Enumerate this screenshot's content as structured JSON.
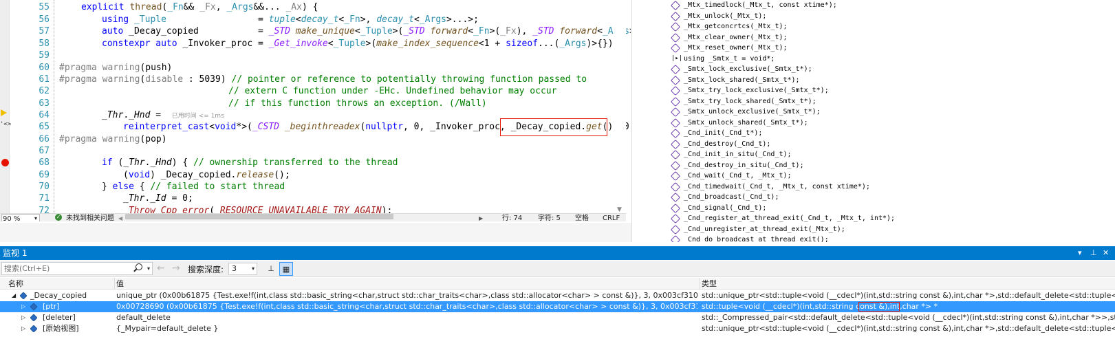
{
  "editor": {
    "line_numbers": [
      "55",
      "56",
      "57",
      "58",
      "59",
      "60",
      "61",
      "62",
      "63",
      "64",
      "65",
      "66",
      "67",
      "68",
      "69",
      "70",
      "71",
      "72"
    ],
    "hint_text": "已用时间 <= 1ms",
    "status": {
      "zoom": "90 %",
      "issues": "未找到相关问题",
      "line": "行: 74",
      "char": "字符: 5",
      "spaces": "空格",
      "eol": "CRLF"
    }
  },
  "right_pane": {
    "items": [
      {
        "icon": "method-icon",
        "text": "_Mtx_timedlock(_Mtx_t, const xtime*);"
      },
      {
        "icon": "method-icon",
        "text": "_Mtx_unlock(_Mtx_t);"
      },
      {
        "icon": "method-icon",
        "text": "_Mtx_getconcrtcs(_Mtx_t);"
      },
      {
        "icon": "method-icon",
        "text": "_Mtx_clear_owner(_Mtx_t);"
      },
      {
        "icon": "method-icon",
        "text": "_Mtx_reset_owner(_Mtx_t);"
      },
      {
        "icon": "typedef-icon",
        "text": "using _Smtx_t = void*;"
      },
      {
        "icon": "method-icon",
        "text": "_Smtx_lock_exclusive(_Smtx_t*);"
      },
      {
        "icon": "method-icon",
        "text": "_Smtx_lock_shared(_Smtx_t*);"
      },
      {
        "icon": "method-icon",
        "text": "_Smtx_try_lock_exclusive(_Smtx_t*);"
      },
      {
        "icon": "method-icon",
        "text": "_Smtx_try_lock_shared(_Smtx_t*);"
      },
      {
        "icon": "method-icon",
        "text": "_Smtx_unlock_exclusive(_Smtx_t*);"
      },
      {
        "icon": "method-icon",
        "text": "_Smtx_unlock_shared(_Smtx_t*);"
      },
      {
        "icon": "method-icon",
        "text": "_Cnd_init(_Cnd_t*);"
      },
      {
        "icon": "method-icon",
        "text": "_Cnd_destroy(_Cnd_t);"
      },
      {
        "icon": "method-icon",
        "text": "_Cnd_init_in_situ(_Cnd_t);"
      },
      {
        "icon": "method-icon",
        "text": "_Cnd_destroy_in_situ(_Cnd_t);"
      },
      {
        "icon": "method-icon",
        "text": "_Cnd_wait(_Cnd_t, _Mtx_t);"
      },
      {
        "icon": "method-icon",
        "text": "_Cnd_timedwait(_Cnd_t, _Mtx_t, const xtime*);"
      },
      {
        "icon": "method-icon",
        "text": "_Cnd_broadcast(_Cnd_t);"
      },
      {
        "icon": "method-icon",
        "text": "_Cnd_signal(_Cnd_t);"
      },
      {
        "icon": "method-icon",
        "text": "_Cnd_register_at_thread_exit(_Cnd_t, _Mtx_t, int*);"
      },
      {
        "icon": "method-icon",
        "text": "_Cnd_unregister_at_thread_exit(_Mtx_t);"
      },
      {
        "icon": "method-icon",
        "text": "_Cnd_do_broadcast_at_thread_exit();"
      }
    ]
  },
  "watch": {
    "title": "监视 1",
    "title_controls": [
      "▾",
      "⊥",
      "✕"
    ],
    "search_placeholder": "搜索(Ctrl+E)",
    "depth_label": "搜索深度:",
    "depth_value": "3",
    "columns": {
      "name": "名称",
      "value": "值",
      "type": "类型"
    },
    "rows": [
      {
        "name": "_Decay_copied",
        "value": "unique_ptr (0x00b61875 {Test.exe!f(int,class std::basic_string<char,struct std::char_traits<char>,class std::allocator<char> > const &)}, 3, 0x003cf310 \"sfad123\")",
        "type": "std::unique_ptr<std::tuple<void (__cdecl*)(int,std::string const &),int,char *>,std::default_delete<std::tuple<v..."
      },
      {
        "name": "[ptr]",
        "value": "0x00728690 (0x00b61875 {Test.exe!f(int,class std::basic_string<char,struct std::char_traits<char>,class std::allocator<char> > const &)}, 3, 0x003cf310 \"sfad123\")",
        "type": "std::tuple<void (__cdecl*)(int,std::string const &),int,char *> *"
      },
      {
        "name": "[deleter]",
        "value": "default_delete",
        "type": "std::_Compressed_pair<std::default_delete<std::tuple<void (__cdecl*)(int,std::string const &),int,char *>>,std::tuple<v..."
      },
      {
        "name": "[原始视图]",
        "value": "{_Mypair=default_delete }",
        "type": "std::unique_ptr<std::tuple<void (__cdecl*)(int,std::string const &),int,char *>,std::default_delete<std::tuple<v..."
      }
    ]
  },
  "colors": {
    "accent": "#007acc",
    "selection": "#3399ff",
    "breakpoint": "#e51400",
    "keyword": "#0000ff",
    "type": "#2b91af",
    "comment": "#008000",
    "macro": "#8a1bff"
  }
}
